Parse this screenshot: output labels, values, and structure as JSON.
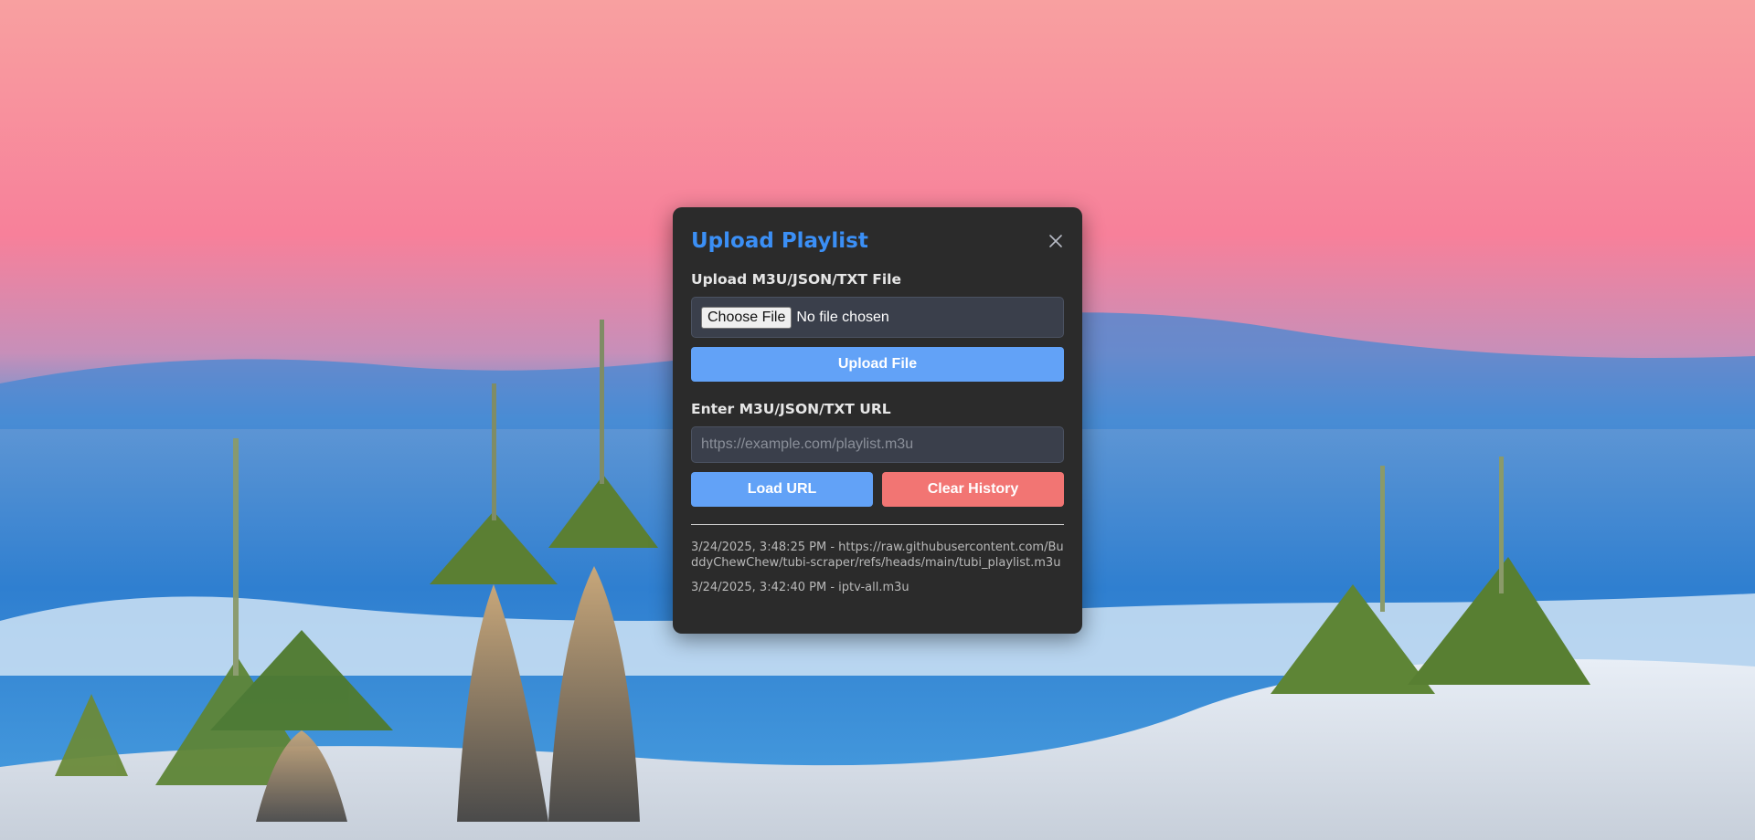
{
  "modal": {
    "title": "Upload Playlist",
    "file_label": "Upload M3U/JSON/TXT File",
    "choose_file_label": "Choose File",
    "file_status": "No file chosen",
    "upload_button": "Upload File",
    "url_label": "Enter M3U/JSON/TXT URL",
    "url_value": "",
    "url_placeholder": "https://example.com/playlist.m3u",
    "load_url_button": "Load URL",
    "clear_history_button": "Clear History",
    "history": [
      "3/24/2025, 3:48:25 PM - https://raw.githubusercontent.com/BuddyChewChew/tubi-scraper/refs/heads/main/tubi_playlist.m3u",
      "3/24/2025, 3:42:40 PM - iptv-all.m3u"
    ]
  },
  "icons": {
    "close": "close-icon"
  },
  "colors": {
    "title_accent": "#3b8ff5",
    "primary_button": "#62a2f7",
    "danger_button": "#f27573",
    "modal_background": "#2b2b2b"
  }
}
